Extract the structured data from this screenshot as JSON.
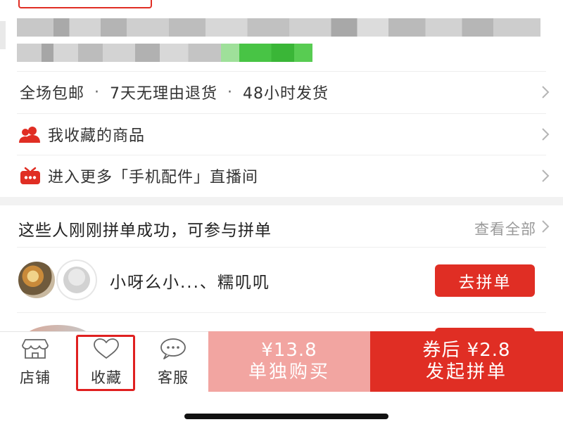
{
  "services_row": {
    "items": [
      "全场包邮",
      "7天无理由退货",
      "48小时发货"
    ],
    "separator": "·",
    "icon": "chevron-right-icon"
  },
  "favorites_row": {
    "label": "我收藏的商品",
    "icon": "users-icon",
    "accent": "#e02e24"
  },
  "live_row": {
    "label": "进入更多「手机配件」直播间",
    "icon": "live-tv-icon",
    "accent": "#e02e24"
  },
  "group_section": {
    "title": "这些人刚刚拼单成功，可参与拼单",
    "view_all": "查看全部",
    "groups": [
      {
        "name": "小呀么小...、糯叽叽",
        "join_label": "去拼单"
      }
    ]
  },
  "bottom_bar": {
    "tabs": [
      {
        "label": "店铺",
        "icon": "store-icon"
      },
      {
        "label": "收藏",
        "icon": "heart-icon",
        "highlighted": true
      },
      {
        "label": "客服",
        "icon": "chat-bubble-icon"
      }
    ],
    "buy_single": {
      "price": "¥13.8",
      "label": "单独购买",
      "color": "#f2a5a1"
    },
    "buy_group": {
      "price": "券后 ¥2.8",
      "label": "发起拼单",
      "color": "#e02e24"
    }
  },
  "colors": {
    "accent": "#e02e24",
    "highlight_border": "#e02020",
    "muted_text": "#999999"
  }
}
